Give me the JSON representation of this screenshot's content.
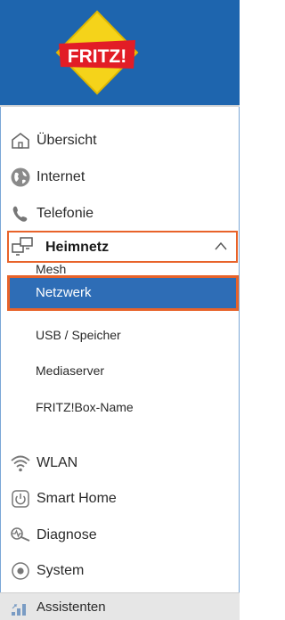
{
  "logo": {
    "text": "FRITZ!"
  },
  "nav": {
    "uebersicht": "Übersicht",
    "internet": "Internet",
    "telefonie": "Telefonie",
    "heimnetz": "Heimnetz",
    "heimnetz_sub": {
      "mesh": "Mesh",
      "netzwerk": "Netzwerk",
      "usb": "USB / Speicher",
      "mediaserver": "Mediaserver",
      "boxname": "FRITZ!Box-Name"
    },
    "wlan": "WLAN",
    "smarthome": "Smart Home",
    "diagnose": "Diagnose",
    "system": "System",
    "assistenten": "Assistenten"
  },
  "colors": {
    "header_blue": "#1e65ae",
    "highlight_orange": "#e8632a",
    "active_blue": "#2e6db6"
  }
}
